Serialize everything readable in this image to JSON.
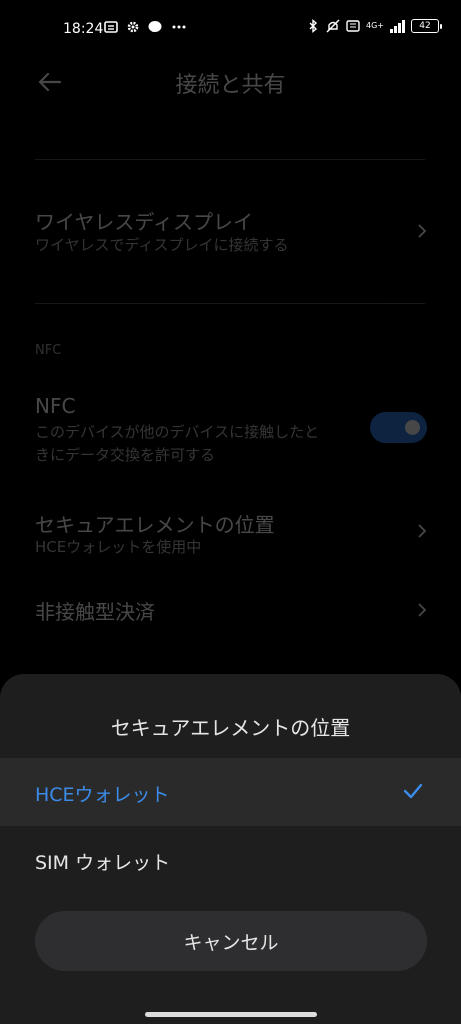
{
  "status_bar": {
    "time": "18:24",
    "network_label": "4G+",
    "battery": "42",
    "icons": [
      "notification-icon",
      "gear-icon",
      "line-app-icon",
      "more-icon",
      "bluetooth-icon",
      "mute-icon",
      "data-icon",
      "signal-icon",
      "battery-icon"
    ]
  },
  "page": {
    "title": "接続と共有",
    "wireless_display": {
      "title": "ワイヤレスディスプレイ",
      "subtitle": "ワイヤレスでディスプレイに接続する"
    },
    "section_nfc": "NFC",
    "nfc": {
      "title": "NFC",
      "subtitle_line1": "このデバイスが他のデバイスに接触したと",
      "subtitle_line2": "きにデータ交換を許可する",
      "enabled": true
    },
    "secure_element": {
      "title": "セキュアエレメントの位置",
      "subtitle": "HCEウォレットを使用中"
    },
    "contactless": {
      "title": "非接触型決済"
    }
  },
  "sheet": {
    "title": "セキュアエレメントの位置",
    "options": [
      {
        "label": "HCEウォレット",
        "selected": true
      },
      {
        "label": "SIM ウォレット",
        "selected": false
      }
    ],
    "cancel_label": "キャンセル"
  },
  "colors": {
    "accent": "#3b8ce8",
    "sheet_bg": "#1e1e1f",
    "selected_row_bg": "#2a2a2b"
  }
}
